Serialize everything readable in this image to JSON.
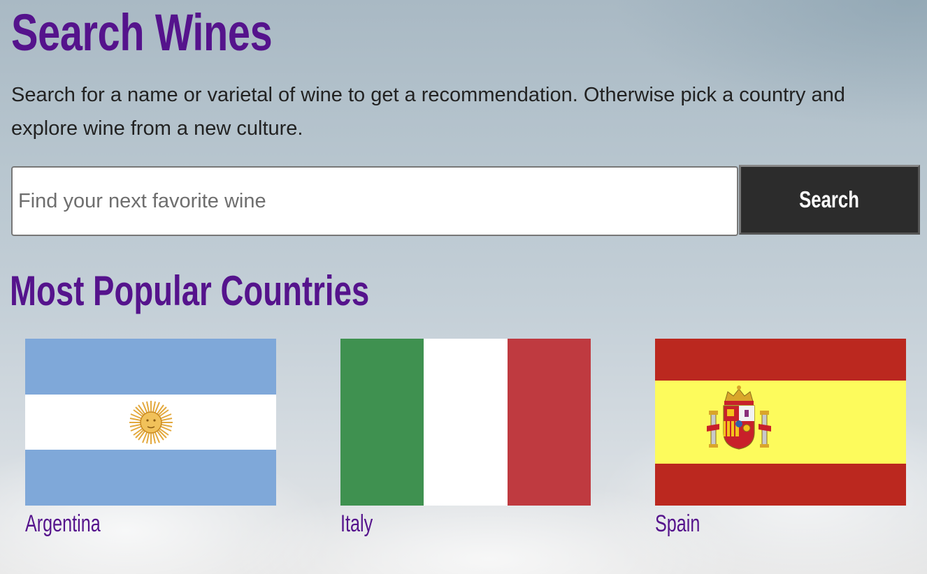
{
  "page": {
    "title": "Search Wines",
    "intro": "Search for a name or varietal of wine to get a recommendation. Otherwise pick a country and explore wine from a new culture."
  },
  "search": {
    "placeholder": "Find your next favorite wine",
    "value": "",
    "button_label": "Search"
  },
  "popular": {
    "heading": "Most Popular Countries",
    "countries": [
      {
        "name": "Argentina",
        "flag_icon": "argentina-flag-icon",
        "colors": [
          "#7fa8d9",
          "#ffffff",
          "#e8b24a"
        ]
      },
      {
        "name": "Italy",
        "flag_icon": "italy-flag-icon",
        "colors": [
          "#3f9150",
          "#ffffff",
          "#bf3a40"
        ]
      },
      {
        "name": "Spain",
        "flag_icon": "spain-flag-icon",
        "colors": [
          "#bb281f",
          "#fdfb5c"
        ]
      }
    ]
  },
  "theme": {
    "accent": "#55138c",
    "button_bg": "#2c2c2c"
  }
}
